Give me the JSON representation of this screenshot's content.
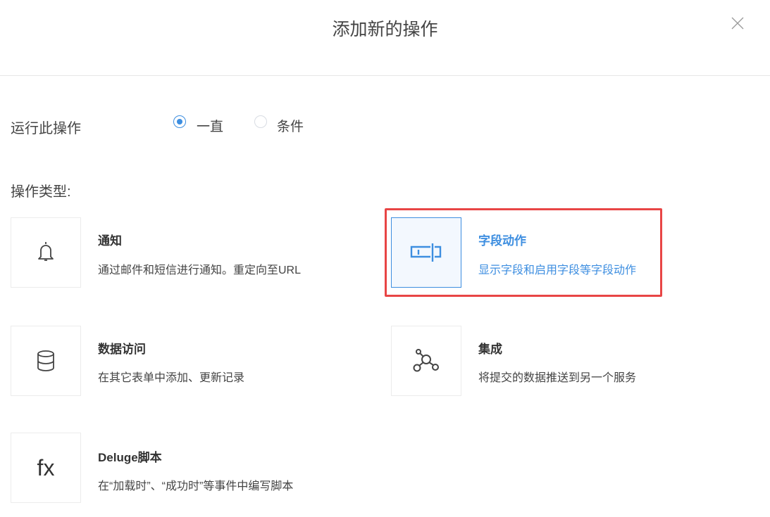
{
  "dialog": {
    "title": "添加新的操作",
    "close_icon": "close-icon"
  },
  "run": {
    "label": "运行此操作",
    "options": [
      {
        "label": "一直",
        "selected": true
      },
      {
        "label": "条件",
        "selected": false
      }
    ]
  },
  "types": {
    "label": "操作类型:",
    "items": [
      {
        "title": "通知",
        "desc": "通过邮件和短信进行通知。重定向至URL",
        "icon": "bell-icon"
      },
      {
        "title": "字段动作",
        "desc": "显示字段和启用字段等字段动作",
        "icon": "field-action-icon",
        "selected": true
      },
      {
        "title": "数据访问",
        "desc": "在其它表单中添加、更新记录",
        "icon": "database-icon"
      },
      {
        "title": "集成",
        "desc": "将提交的数据推送到另一个服务",
        "icon": "integration-icon"
      },
      {
        "title": "Deluge脚本",
        "desc": "在“加载时”、“成功时”等事件中编写脚本",
        "icon": "fx-icon",
        "icon_text": "fx"
      }
    ]
  },
  "colors": {
    "accent": "#3d8ee0",
    "highlight": "#e84545"
  }
}
